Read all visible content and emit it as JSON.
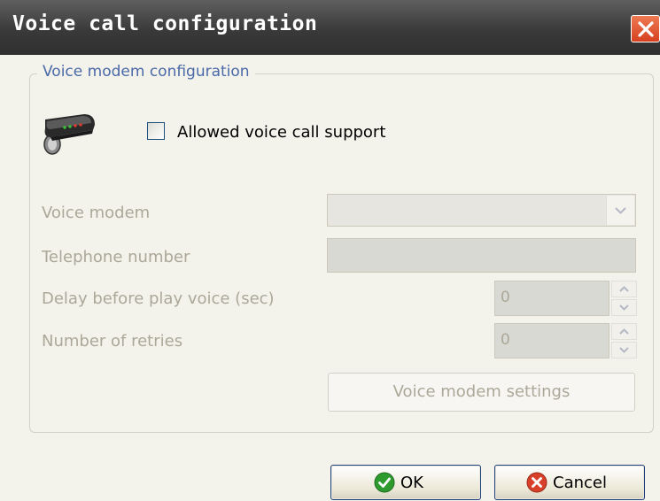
{
  "window": {
    "title": "Voice call configuration"
  },
  "group": {
    "legend": "Voice modem configuration",
    "checkbox_label": "Allowed voice call support",
    "checkbox_checked": false
  },
  "fields": {
    "voice_modem_label": "Voice modem",
    "voice_modem_value": "",
    "telephone_label": "Telephone number",
    "telephone_value": "",
    "delay_label": "Delay before play voice (sec)",
    "delay_value": "0",
    "retries_label": "Number of retries",
    "retries_value": "0"
  },
  "buttons": {
    "settings": "Voice modem settings",
    "ok": "OK",
    "cancel": "Cancel"
  },
  "colors": {
    "disabled_text": "#aca899",
    "legend": "#4a69a8",
    "ok_green": "#2f9b2f",
    "cancel_red": "#d8402a"
  },
  "icons": [
    "modem-icon",
    "close-icon",
    "check-circle-icon",
    "x-circle-icon"
  ]
}
